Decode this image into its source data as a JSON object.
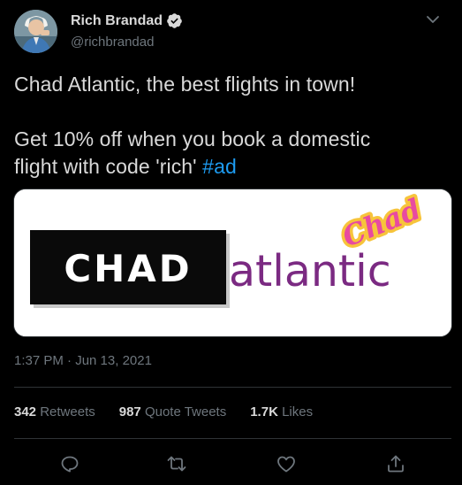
{
  "author": {
    "name": "Rich Brandad",
    "handle": "@richbrandad",
    "verified_icon": "verified-badge-icon",
    "avatar_icon": "avatar-photo"
  },
  "tweet": {
    "line1": "Chad Atlantic, the best flights in town!",
    "line2_start": "Get 10% off when you book a domestic",
    "line3_start": "flight with code 'rich'",
    "hashtag": "#ad"
  },
  "media": {
    "logo_block_text": "CHAD",
    "logo_word": "atlantic",
    "logo_script": "Chad"
  },
  "timestamp": "1:37 PM · Jun 13, 2021",
  "stats": {
    "retweets_count": "342",
    "retweets_label": "Retweets",
    "quotes_count": "987",
    "quotes_label": "Quote Tweets",
    "likes_count": "1.7K",
    "likes_label": "Likes"
  },
  "actions": [
    "reply-icon",
    "retweet-icon",
    "like-icon",
    "share-icon"
  ],
  "colors": {
    "background": "#000000",
    "text": "#d9d9d9",
    "secondary": "#6e767d",
    "link": "#1d9bf0",
    "divider": "#2f3336",
    "logo_purple": "#7b2a82"
  }
}
